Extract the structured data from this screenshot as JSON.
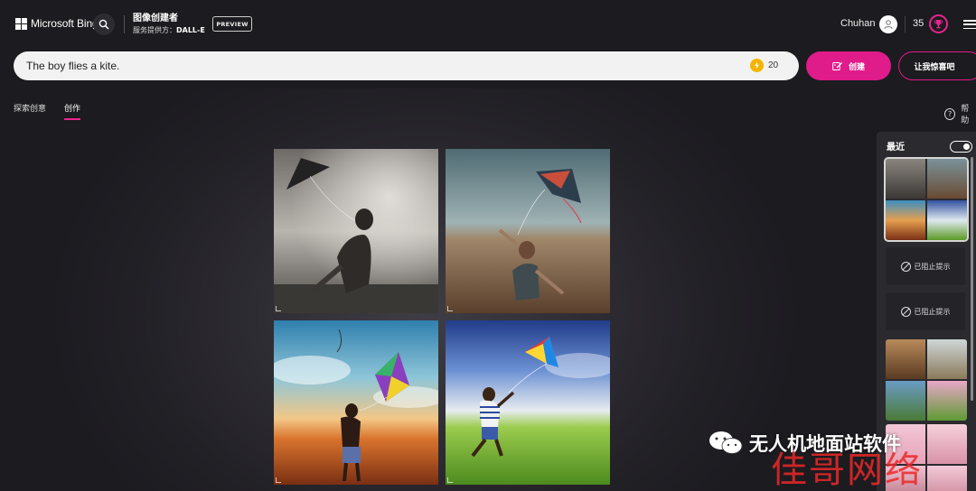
{
  "header": {
    "brand": "Microsoft Bing",
    "title": "图像创建者",
    "provider_label": "服务提供方：",
    "provider_value": "DALL-E",
    "badge": "PREVIEW",
    "user_name": "Chuhan",
    "coins": "35"
  },
  "prompt": {
    "value": "The boy flies a kite.",
    "boosts": "20"
  },
  "actions": {
    "create": "创建",
    "surprise": "让我惊喜吧"
  },
  "tabs": [
    {
      "label": "探索创意"
    },
    {
      "label": "创作"
    }
  ],
  "help": {
    "label": "帮助"
  },
  "images": [
    {
      "name": "kite-image-1",
      "style": "black-and-white"
    },
    {
      "name": "kite-image-2",
      "style": "field-dusk"
    },
    {
      "name": "kite-image-3",
      "style": "sunset-colorful"
    },
    {
      "name": "kite-image-4",
      "style": "green-field-blue-sky"
    }
  ],
  "recent": {
    "title": "最近",
    "blocked_label_1": "已阻止提示",
    "blocked_label_2": "已阻止提示"
  },
  "watermark": {
    "text": "无人机地面站软件",
    "overlay": "佳哥网络"
  },
  "colors": {
    "accent": "#e01b8a",
    "header_bg": "#1c1b1f",
    "panel_bg": "#2b2a2f"
  }
}
